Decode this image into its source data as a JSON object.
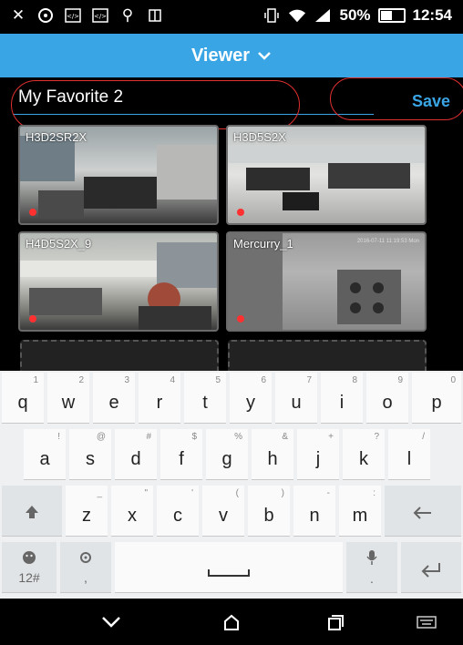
{
  "status_bar": {
    "battery": "50%",
    "time": "12:54",
    "icons_left": [
      "mute-icon",
      "chat-icon",
      "code-icon",
      "code-icon",
      "usb-icon",
      "app-icon"
    ],
    "icons_right": [
      "vibrate-icon",
      "wifi-icon",
      "signal-icon",
      "battery-icon"
    ]
  },
  "header": {
    "title": "Viewer",
    "dropdown_icon": "chevron-down-icon"
  },
  "favorite": {
    "name_value": "My Favorite 2",
    "save_label": "Save"
  },
  "cameras": [
    {
      "label": "H3D2SR2X",
      "recording": true
    },
    {
      "label": "H3D5S2X",
      "recording": true
    },
    {
      "label": "H4D5S2X_9",
      "recording": true
    },
    {
      "label": "Mercurry_1",
      "timestamp": "2016-07-11 11:19:53 Mon",
      "recording": true
    }
  ],
  "keyboard": {
    "row1": [
      {
        "key": "q",
        "hint": "1"
      },
      {
        "key": "w",
        "hint": "2"
      },
      {
        "key": "e",
        "hint": "3"
      },
      {
        "key": "r",
        "hint": "4"
      },
      {
        "key": "t",
        "hint": "5"
      },
      {
        "key": "y",
        "hint": "6"
      },
      {
        "key": "u",
        "hint": "7"
      },
      {
        "key": "i",
        "hint": "8"
      },
      {
        "key": "o",
        "hint": "9"
      },
      {
        "key": "p",
        "hint": "0"
      }
    ],
    "row2": [
      {
        "key": "a",
        "hint": "!"
      },
      {
        "key": "s",
        "hint": "@"
      },
      {
        "key": "d",
        "hint": "#"
      },
      {
        "key": "f",
        "hint": "$"
      },
      {
        "key": "g",
        "hint": "%"
      },
      {
        "key": "h",
        "hint": "&"
      },
      {
        "key": "j",
        "hint": "+"
      },
      {
        "key": "k",
        "hint": "?"
      },
      {
        "key": "l",
        "hint": "/"
      }
    ],
    "row3": [
      {
        "key": "z",
        "hint": "_"
      },
      {
        "key": "x",
        "hint": "\""
      },
      {
        "key": "c",
        "hint": "'"
      },
      {
        "key": "v",
        "hint": "("
      },
      {
        "key": "b",
        "hint": ")"
      },
      {
        "key": "n",
        "hint": "-"
      },
      {
        "key": "m",
        "hint": ":"
      }
    ],
    "symbols_label": "12#",
    "comma_label": ",",
    "period_label": "."
  },
  "nav": {
    "icons": [
      "back-icon",
      "home-icon",
      "recents-icon",
      "keyboard-icon"
    ]
  }
}
